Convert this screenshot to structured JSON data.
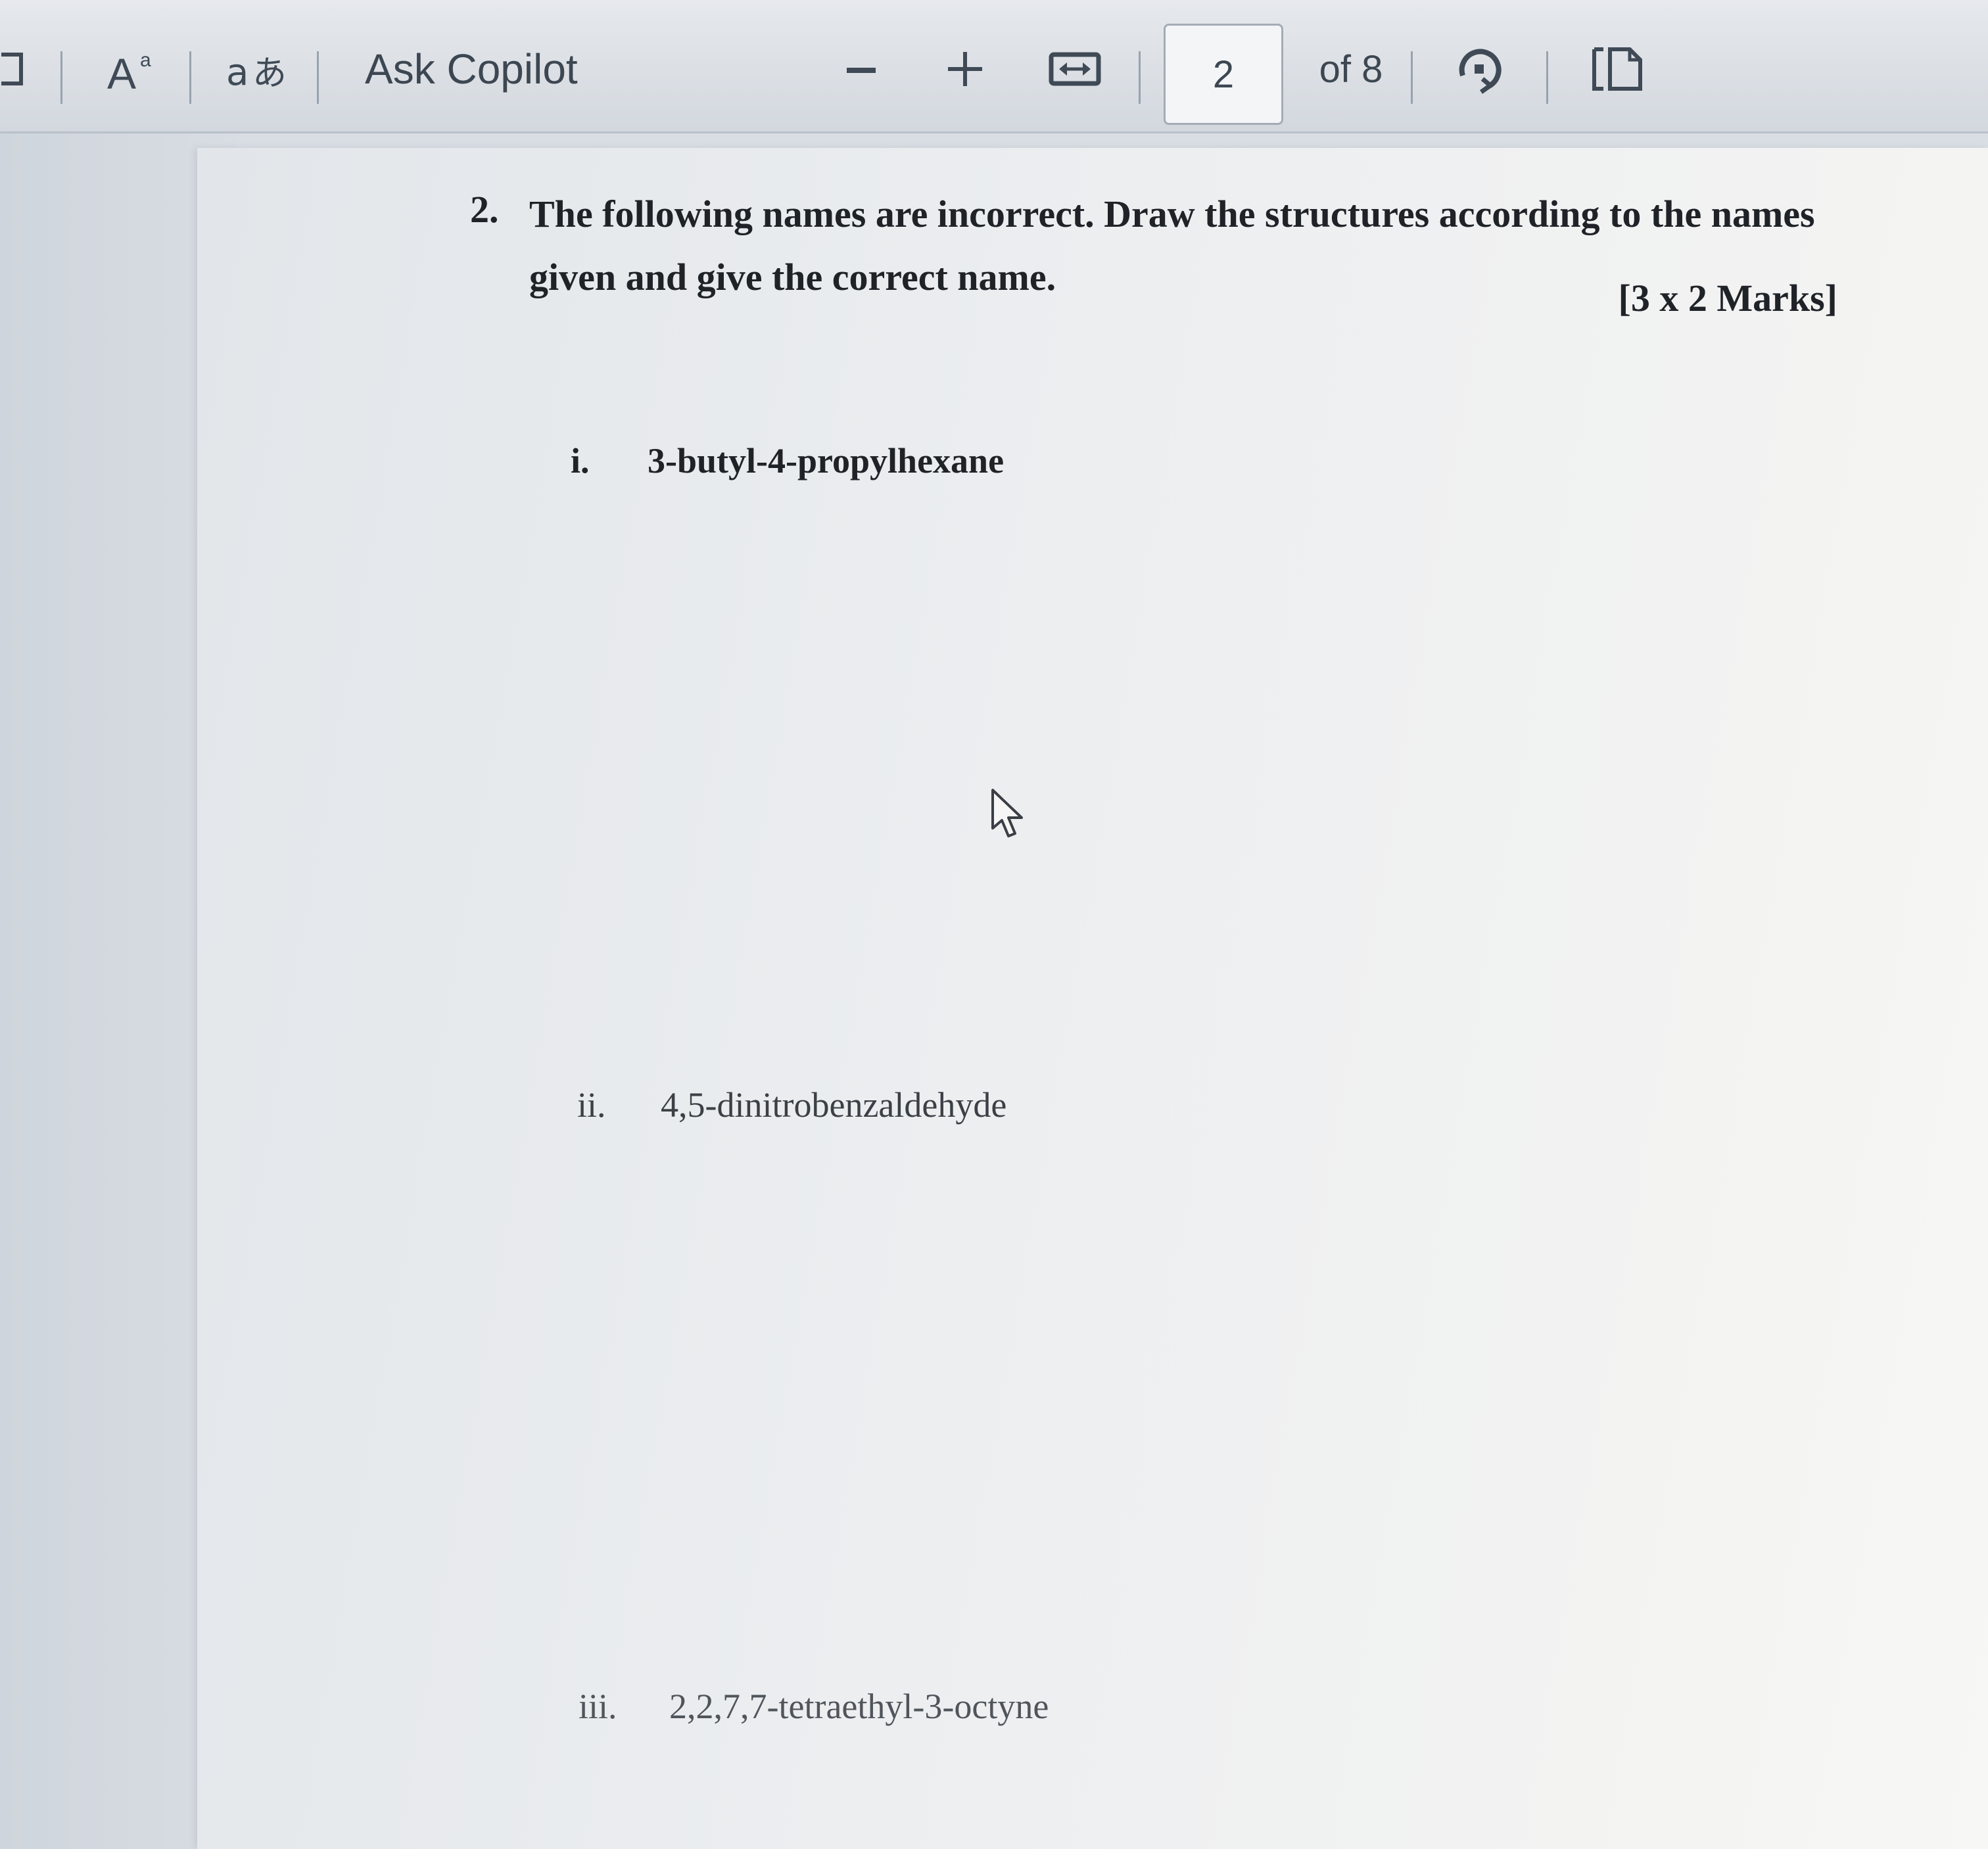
{
  "toolbar": {
    "font_size_icon": "text-size-icon",
    "translate_icon": "translate-icon",
    "ask_copilot_label": "Ask Copilot",
    "zoom_out_label": "—",
    "zoom_in_label": "+",
    "fit_icon": "fit-width-icon",
    "current_page": "2",
    "page_count_label": "of 8",
    "rotate_icon": "rotate-icon",
    "page_view_icon": "page-view-icon"
  },
  "document": {
    "question_number": "2.",
    "question_text": "The following names are incorrect. Draw the structures according to the names given and give the correct name.",
    "marks": "[3 x 2 Marks]",
    "items": [
      {
        "number": "i.",
        "text": "3-butyl-4-propylhexane"
      },
      {
        "number": "ii.",
        "text": "4,5-dinitrobenzaldehyde"
      },
      {
        "number": "iii.",
        "text": "2,2,7,7-tetraethyl-3-octyne"
      }
    ]
  },
  "colors": {
    "toolbar_bg": "#dde1e6",
    "page_bg": "#eceef0",
    "text": "#1f2328"
  }
}
